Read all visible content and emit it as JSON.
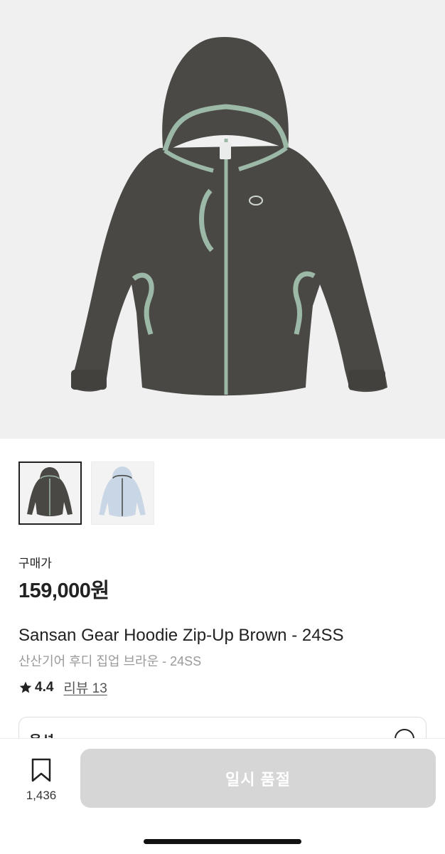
{
  "product": {
    "price_label": "구매가",
    "price": "159,000원",
    "name_en": "Sansan Gear Hoodie Zip-Up Brown - 24SS",
    "name_ko": "산산기어 후디 집업 브라운 - 24SS",
    "rating": "4.4",
    "review_text": "리뷰 13"
  },
  "images": {
    "thumbnails": [
      {
        "color": "#4a4845",
        "selected": true
      },
      {
        "color": "#c9d6e6",
        "selected": false
      }
    ]
  },
  "option": {
    "label": "옵션"
  },
  "bottom_bar": {
    "wishlist_count": "1,436",
    "soldout_label": "일시 품절"
  },
  "colors": {
    "hoodie_brown": "#4a4845",
    "trim_mint": "#9cb8a6",
    "disabled_button": "#d6d6d6"
  }
}
